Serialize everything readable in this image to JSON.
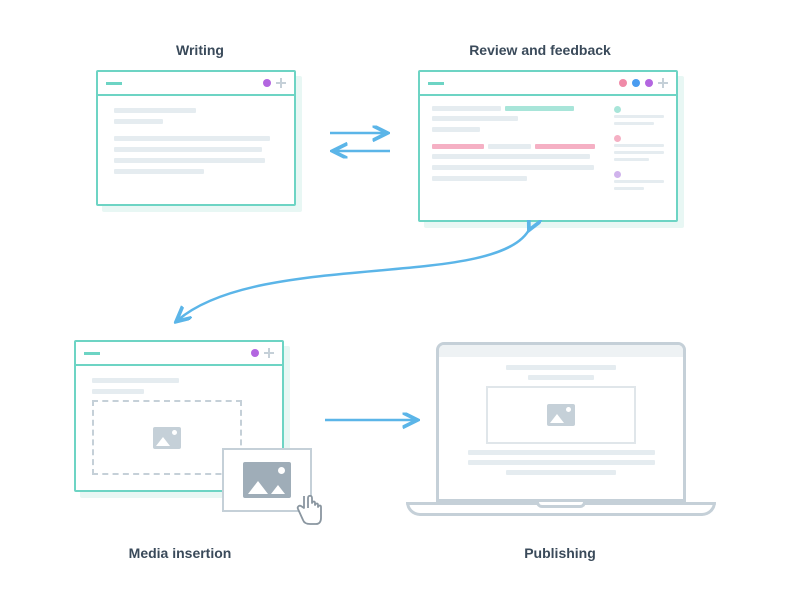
{
  "labels": {
    "writing": "Writing",
    "review": "Review and feedback",
    "media": "Media insertion",
    "publishing": "Publishing"
  },
  "colors": {
    "teal": "#6dd4c4",
    "tealLight": "#a8e5d9",
    "purple": "#b366e0",
    "blue": "#4a9cf0",
    "pink": "#f08aa8",
    "grey": "#c5d0d8",
    "textGrey": "#e5ecf0",
    "arrow": "#5bb5e8"
  },
  "icons": {
    "menu": "menu-icon",
    "plus": "plus-icon",
    "image": "image-icon",
    "pointer": "pointer-cursor-icon"
  }
}
